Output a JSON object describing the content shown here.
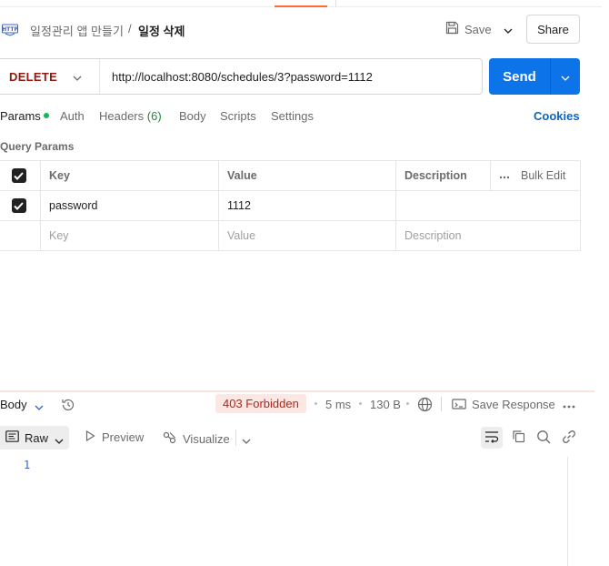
{
  "header": {
    "breadcrumb_parent": "일정관리 앱 만들기",
    "breadcrumb_separator": "/",
    "breadcrumb_current": "일정 삭제",
    "save_label": "Save",
    "share_label": "Share"
  },
  "request": {
    "method": "DELETE",
    "url": "http://localhost:8080/schedules/3?password=1112",
    "send_label": "Send"
  },
  "tabs": [
    {
      "label": "Params",
      "active": true
    },
    {
      "label": "Auth"
    },
    {
      "label": "Headers",
      "count": "(6)"
    },
    {
      "label": "Body"
    },
    {
      "label": "Scripts"
    },
    {
      "label": "Settings"
    }
  ],
  "cookies_label": "Cookies",
  "query_params": {
    "title": "Query Params",
    "columns": {
      "key": "Key",
      "value": "Value",
      "description": "Description"
    },
    "bulk_edit_label": "Bulk Edit",
    "rows": [
      {
        "checked": true,
        "key": "password",
        "value": "1112",
        "description": ""
      }
    ],
    "placeholder": {
      "key": "Key",
      "value": "Value",
      "description": "Description"
    }
  },
  "response": {
    "body_label": "Body",
    "status": "403 Forbidden",
    "time": "5 ms",
    "size": "130 B",
    "save_response_label": "Save Response",
    "view_mode": "Raw",
    "preview_label": "Preview",
    "visualize_label": "Visualize",
    "line_number": "1"
  },
  "colors": {
    "method": "#8e1a10",
    "send": "#0c73e8",
    "status_bg": "#fde7e3",
    "status_text": "#b4261a",
    "accent": "#ff6c37"
  },
  "icons": {
    "request_type": "http-icon",
    "save": "save-icon",
    "history": "history-icon",
    "network": "globe-icon",
    "wrap": "wrap-lines-icon",
    "copy": "copy-icon",
    "search": "search-icon",
    "link": "link-icon"
  }
}
